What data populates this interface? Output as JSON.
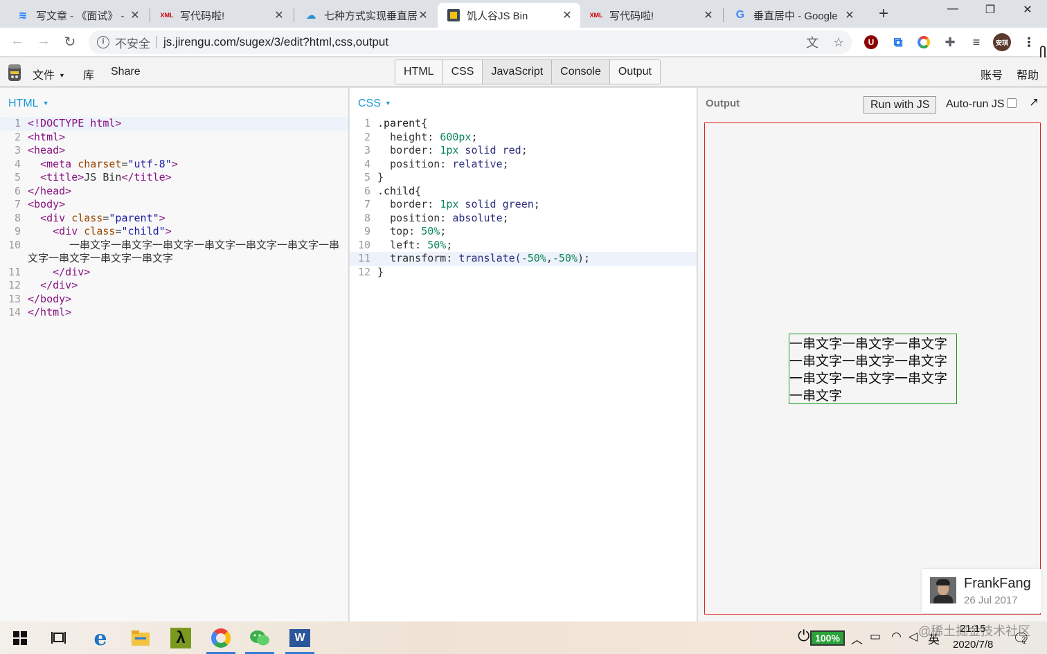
{
  "browser": {
    "tabs": [
      {
        "title": "写文章 - 《面试》 - ",
        "favicon": "juejin-icon"
      },
      {
        "title": "写代码啦!",
        "favicon": "xml-icon"
      },
      {
        "title": "七种方式实现垂直居",
        "favicon": "cloud-icon"
      },
      {
        "title": "饥人谷JS Bin",
        "favicon": "jsbin-icon"
      },
      {
        "title": "写代码啦!",
        "favicon": "xml-icon"
      },
      {
        "title": "垂直居中 - Google",
        "favicon": "google-icon"
      }
    ],
    "active_tab": 3,
    "new_tab": "+",
    "address": {
      "security": "不安全",
      "url": "js.jirengu.com/sugex/3/edit?html,css,output"
    },
    "profile_initials": "安琪",
    "extension_badge": "U"
  },
  "jsbin": {
    "menu": {
      "file": "文件",
      "library": "库",
      "share": "Share",
      "account": "账号",
      "help": "帮助"
    },
    "panels": [
      "HTML",
      "CSS",
      "JavaScript",
      "Console",
      "Output"
    ],
    "html_panel_label": "HTML",
    "css_panel_label": "CSS",
    "output_label": "Output",
    "run_button": "Run with JS",
    "autorun_label": "Auto-run JS",
    "author": {
      "name": "FrankFang",
      "date": "26 Jul 2017"
    },
    "output_text_lines": [
      "一串文字一串文字一串文字",
      "一串文字一串文字一串文字",
      "一串文字一串文字一串文字",
      "一串文字"
    ]
  },
  "html_code": {
    "line_numbers": [
      "1",
      "2",
      "3",
      "4",
      "5",
      "6",
      "7",
      "8",
      "9",
      "10",
      "11",
      "12",
      "13",
      "14"
    ],
    "l1": "<!DOCTYPE html>",
    "l2": "<html>",
    "l3": "<head>",
    "l4_tag": "<meta ",
    "l4_attr": "charset",
    "l4_eq": "=",
    "l4_val": "\"utf-8\"",
    "l4_end": ">",
    "l5_open": "<title>",
    "l5_text": "JS Bin",
    "l5_close": "</title>",
    "l6": "</head>",
    "l7": "<body>",
    "l8_tag": "<div ",
    "l8_attr": "class",
    "l8_eq": "=",
    "l8_val": "\"parent\"",
    "l8_end": ">",
    "l9_tag": "<div ",
    "l9_attr": "class",
    "l9_eq": "=",
    "l9_val": "\"child\"",
    "l9_end": ">",
    "l10": "一串文字一串文字一串文字一串文字一串文字一串文字一串文字一串文字一串文字一串文字",
    "l11": "</div>",
    "l12": "</div>",
    "l13": "</body>",
    "l14": "</html>"
  },
  "css_code": {
    "line_numbers": [
      "1",
      "2",
      "3",
      "4",
      "5",
      "6",
      "7",
      "8",
      "9",
      "10",
      "11",
      "12"
    ],
    "l1": ".parent{",
    "l2_prop": "height: ",
    "l2_val": "600px",
    "l3_prop": "border: ",
    "l3_num": "1px",
    "l3_kw": " solid ",
    "l3_color": "red",
    "l4_prop": "position: ",
    "l4_val": "relative",
    "l5": "}",
    "l6": ".child{",
    "l7_prop": "border: ",
    "l7_num": "1px",
    "l7_kw": " solid ",
    "l7_color": "green",
    "l8_prop": "position: ",
    "l8_val": "absolute",
    "l9_prop": "top: ",
    "l9_val": "50%",
    "l10_prop": "left: ",
    "l10_val": "50%",
    "l11_prop": "transform: ",
    "l11_fn": "translate(",
    "l11_a": "-50%",
    "l11_comma": ",",
    "l11_b": "-50%",
    "l11_end": ");",
    "l12": "}"
  },
  "taskbar": {
    "battery": "100%",
    "ime": "英",
    "time": "21:15",
    "date": "2020/7/8",
    "watermark": "@稀土掘金技术社区",
    "notifications": "2"
  },
  "colors": {
    "accent_blue": "#1a9ad6",
    "parent_border": "#e02020",
    "child_border": "#1a9a1a"
  }
}
